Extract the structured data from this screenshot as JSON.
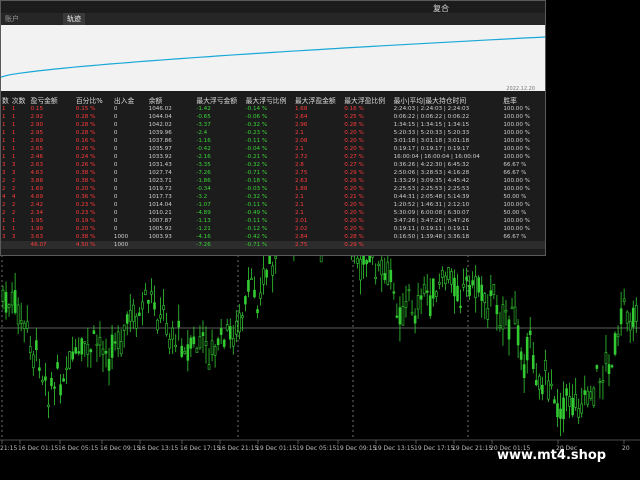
{
  "window": {
    "title": "复合"
  },
  "tabs": [
    {
      "label": "账户",
      "active": false
    },
    {
      "label": "轨迹",
      "active": true
    }
  ],
  "equity": {
    "date_label": "2022.12.20",
    "line_color": "#1aa8d8"
  },
  "table": {
    "headers": [
      "数",
      "次数",
      "盈亏金额",
      "百分比%",
      "出入金",
      "余额",
      "最大浮亏金额",
      "最大浮亏比例",
      "最大浮盈金额",
      "最大浮盈比例",
      "最小|平均|最大持仓时间",
      "胜率"
    ],
    "rows": [
      [
        "1",
        "1",
        "0.15",
        "0.15 %",
        "0",
        "1046.02",
        "-1.42",
        "-0.14 %",
        "1.68",
        "0.16 %",
        "2:24:03 | 2:24:03 | 2:24:03",
        "100.00 %"
      ],
      [
        "1",
        "1",
        "2.92",
        "0.28 %",
        "0",
        "1044.04",
        "-0.65",
        "-0.06 %",
        "2.64",
        "0.25 %",
        "0:06:22 | 0:06:22 | 0:06:22",
        "100.00 %"
      ],
      [
        "1",
        "1",
        "2.90",
        "0.28 %",
        "0",
        "1042.02",
        "-3.37",
        "-0.32 %",
        "2.96",
        "0.28 %",
        "1:34:15 | 1:34:15 | 1:34:15",
        "100.00 %"
      ],
      [
        "1",
        "1",
        "2.95",
        "0.28 %",
        "0",
        "1039.96",
        "-2.4",
        "-0.23 %",
        "2.1",
        "0.20 %",
        "5:20:33 | 5:20:33 | 5:20:33",
        "100.00 %"
      ],
      [
        "1",
        "1",
        "2.69",
        "0.16 %",
        "0",
        "1037.86",
        "-1.16",
        "-0.11 %",
        "2.08",
        "0.20 %",
        "3:01:18 | 3:01:18 | 3:01:18",
        "100.00 %"
      ],
      [
        "1",
        "1",
        "2.65",
        "0.26 %",
        "0",
        "1035.97",
        "-0.42",
        "-0.04 %",
        "2.1",
        "0.20 %",
        "0:19:17 | 0:19:17 | 0:19:17",
        "100.00 %"
      ],
      [
        "1",
        "1",
        "2.46",
        "0.24 %",
        "0",
        "1033.92",
        "-2.16",
        "-0.21 %",
        "2.72",
        "0.27 %",
        "16:00:04 | 16:00:04 | 16:00:04",
        "100.00 %"
      ],
      [
        "3",
        "3",
        "2.63",
        "0.26 %",
        "0",
        "1031.43",
        "-3.35",
        "-0.32 %",
        "2.8",
        "0.27 %",
        "0:36:26 | 4:22:30 | 6:45:32",
        "66.67 %"
      ],
      [
        "3",
        "3",
        "4.63",
        "0.38 %",
        "0",
        "1027.74",
        "-7.26",
        "-0.71 %",
        "2.75",
        "0.29 %",
        "2:50:06 | 3:28:53 | 4:16:28",
        "66.67 %"
      ],
      [
        "2",
        "2",
        "3.88",
        "0.38 %",
        "0",
        "1023.71",
        "-1.86",
        "-0.18 %",
        "2.63",
        "0.26 %",
        "1:33:29 | 3:09:35 | 4:45:42",
        "100.00 %"
      ],
      [
        "2",
        "2",
        "1.69",
        "0.20 %",
        "0",
        "1019.72",
        "-0.34",
        "-0.03 %",
        "1.88",
        "0.20 %",
        "2:25:53 | 2:25:53 | 2:25:53",
        "100.00 %"
      ],
      [
        "4",
        "4",
        "4.69",
        "0.36 %",
        "0",
        "1017.73",
        "-3.2",
        "-0.32 %",
        "2.1",
        "0.21 %",
        "0:44:31 | 2:05:48 | 5:14:39",
        "50.00 %"
      ],
      [
        "2",
        "2",
        "2.42",
        "0.23 %",
        "0",
        "1014.04",
        "-1.07",
        "-0.11 %",
        "2.1",
        "0.20 %",
        "1:20:52 | 1:46:31 | 2:12:10",
        "100.00 %"
      ],
      [
        "2",
        "2",
        "2.34",
        "0.23 %",
        "0",
        "1010.21",
        "-4.89",
        "-0.49 %",
        "2.1",
        "0.20 %",
        "5:30:09 | 6:00:08 | 6:30:07",
        "50.00 %"
      ],
      [
        "1",
        "1",
        "1.95",
        "0.19 %",
        "0",
        "1007.87",
        "-1.13",
        "-0.11 %",
        "2.01",
        "0.20 %",
        "3:47:26 | 3:47:26 | 3:47:26",
        "100.00 %"
      ],
      [
        "1",
        "1",
        "1.99",
        "0.20 %",
        "0",
        "1005.92",
        "-1.21",
        "-0.12 %",
        "2.02",
        "0.20 %",
        "0:19:11 | 0:19:11 | 0:19:11",
        "100.00 %"
      ],
      [
        "3",
        "3",
        "3.63",
        "0.38 %",
        "1000",
        "1003.93",
        "-4.16",
        "-0.42 %",
        "2.84",
        "0.28 %",
        "0:16:50 | 1:39:48 | 3:36:18",
        "66.67 %"
      ]
    ],
    "total": [
      "",
      "",
      "46.07",
      "4.50 %",
      "1000",
      "",
      "-7.26",
      "-0.71 %",
      "2.75",
      "0.29 %",
      "",
      ""
    ]
  },
  "price_chart": {
    "candle_color": "#33cc33",
    "time_labels": [
      "21:15",
      "16 Dec 01:15",
      "16 Dec 05:15",
      "16 Dec 09:15",
      "16 Dec 13:15",
      "16 Dec 17:15",
      "16 Dec 21:15",
      "19 Dec 01:15",
      "19 Dec 05:15",
      "19 Dec 09:15",
      "19 Dec 13:15",
      "19 Dec 17:15",
      "19 Dec 21:15",
      "20 Dec 01:15",
      "20 Dec",
      "20"
    ]
  },
  "watermark": "www.mt4.shop"
}
